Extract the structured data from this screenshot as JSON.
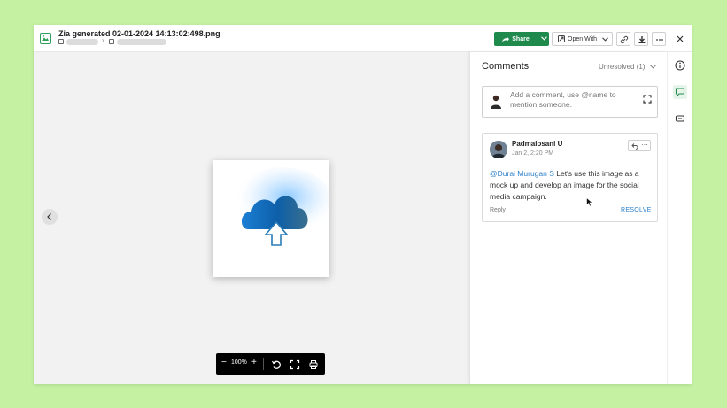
{
  "file": {
    "title": "Zia generated 02-01-2024 14:13:02:498.png"
  },
  "header": {
    "share_label": "Share",
    "open_with_label": "Open With"
  },
  "viewer": {
    "zoom_level": "100%",
    "zoom_out": "−",
    "zoom_in": "+"
  },
  "comments": {
    "title": "Comments",
    "filter_label": "Unresolved (1)",
    "input_placeholder": "Add a comment, use @name to mention someone.",
    "items": [
      {
        "author": "Padmalosani U",
        "date": "Jan 2, 2:20 PM",
        "mention": "@Durai Murugan S",
        "text": " Let's use this image as a mock up and develop an image for the social media campaign.",
        "reply_label": "Reply",
        "resolve_label": "RESOLVE",
        "more_label": "···"
      }
    ]
  },
  "colors": {
    "accent_green": "#1f8a4c",
    "link_blue": "#2c7fc9",
    "background": "#c4f2a2"
  }
}
